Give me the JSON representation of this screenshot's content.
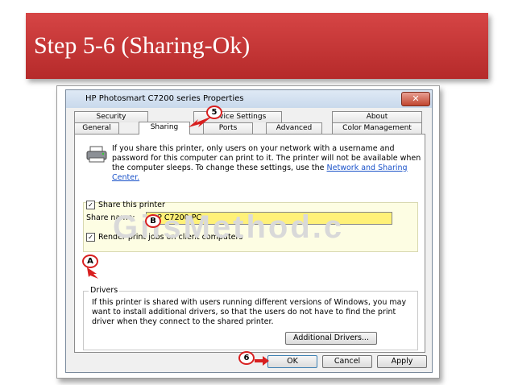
{
  "banner": {
    "title": "Step 5-6 (Sharing-Ok)"
  },
  "dialog": {
    "title": "HP Photosmart C7200 series Properties",
    "close_label": "✕",
    "tabs_row1": [
      "Security",
      "Device Settings",
      "About"
    ],
    "tabs_row2": [
      "General",
      "Sharing",
      "Ports",
      "Advanced",
      "Color Management"
    ],
    "active_tab": "Sharing",
    "info_text": "If you share this printer, only users on your network with a username and password for this computer can print to it. The printer will not be available when the computer sleeps. To change these settings, use the",
    "info_link": "Network and Sharing Center.",
    "share_checkbox_label": "Share this printer",
    "share_checkbox_checked": true,
    "share_name_label": "Share name:",
    "share_name_value": "HP C7200 PC",
    "render_checkbox_label": "Render print jobs on client computers",
    "render_checkbox_checked": true,
    "drivers_legend": "Drivers",
    "drivers_text": "If this printer is shared with users running different versions of Windows, you may want to install additional drivers, so that the users do not have to find the print driver when they connect to the shared printer.",
    "additional_drivers_label": "Additional Drivers...",
    "ok_label": "OK",
    "cancel_label": "Cancel",
    "apply_label": "Apply"
  },
  "watermark": "GilsMethod.c",
  "markers": {
    "step5": "5",
    "step6": "6",
    "a": "A",
    "b": "B"
  },
  "colors": {
    "banner": "#c43333",
    "highlight": "#fff178",
    "marker": "#d82020"
  }
}
